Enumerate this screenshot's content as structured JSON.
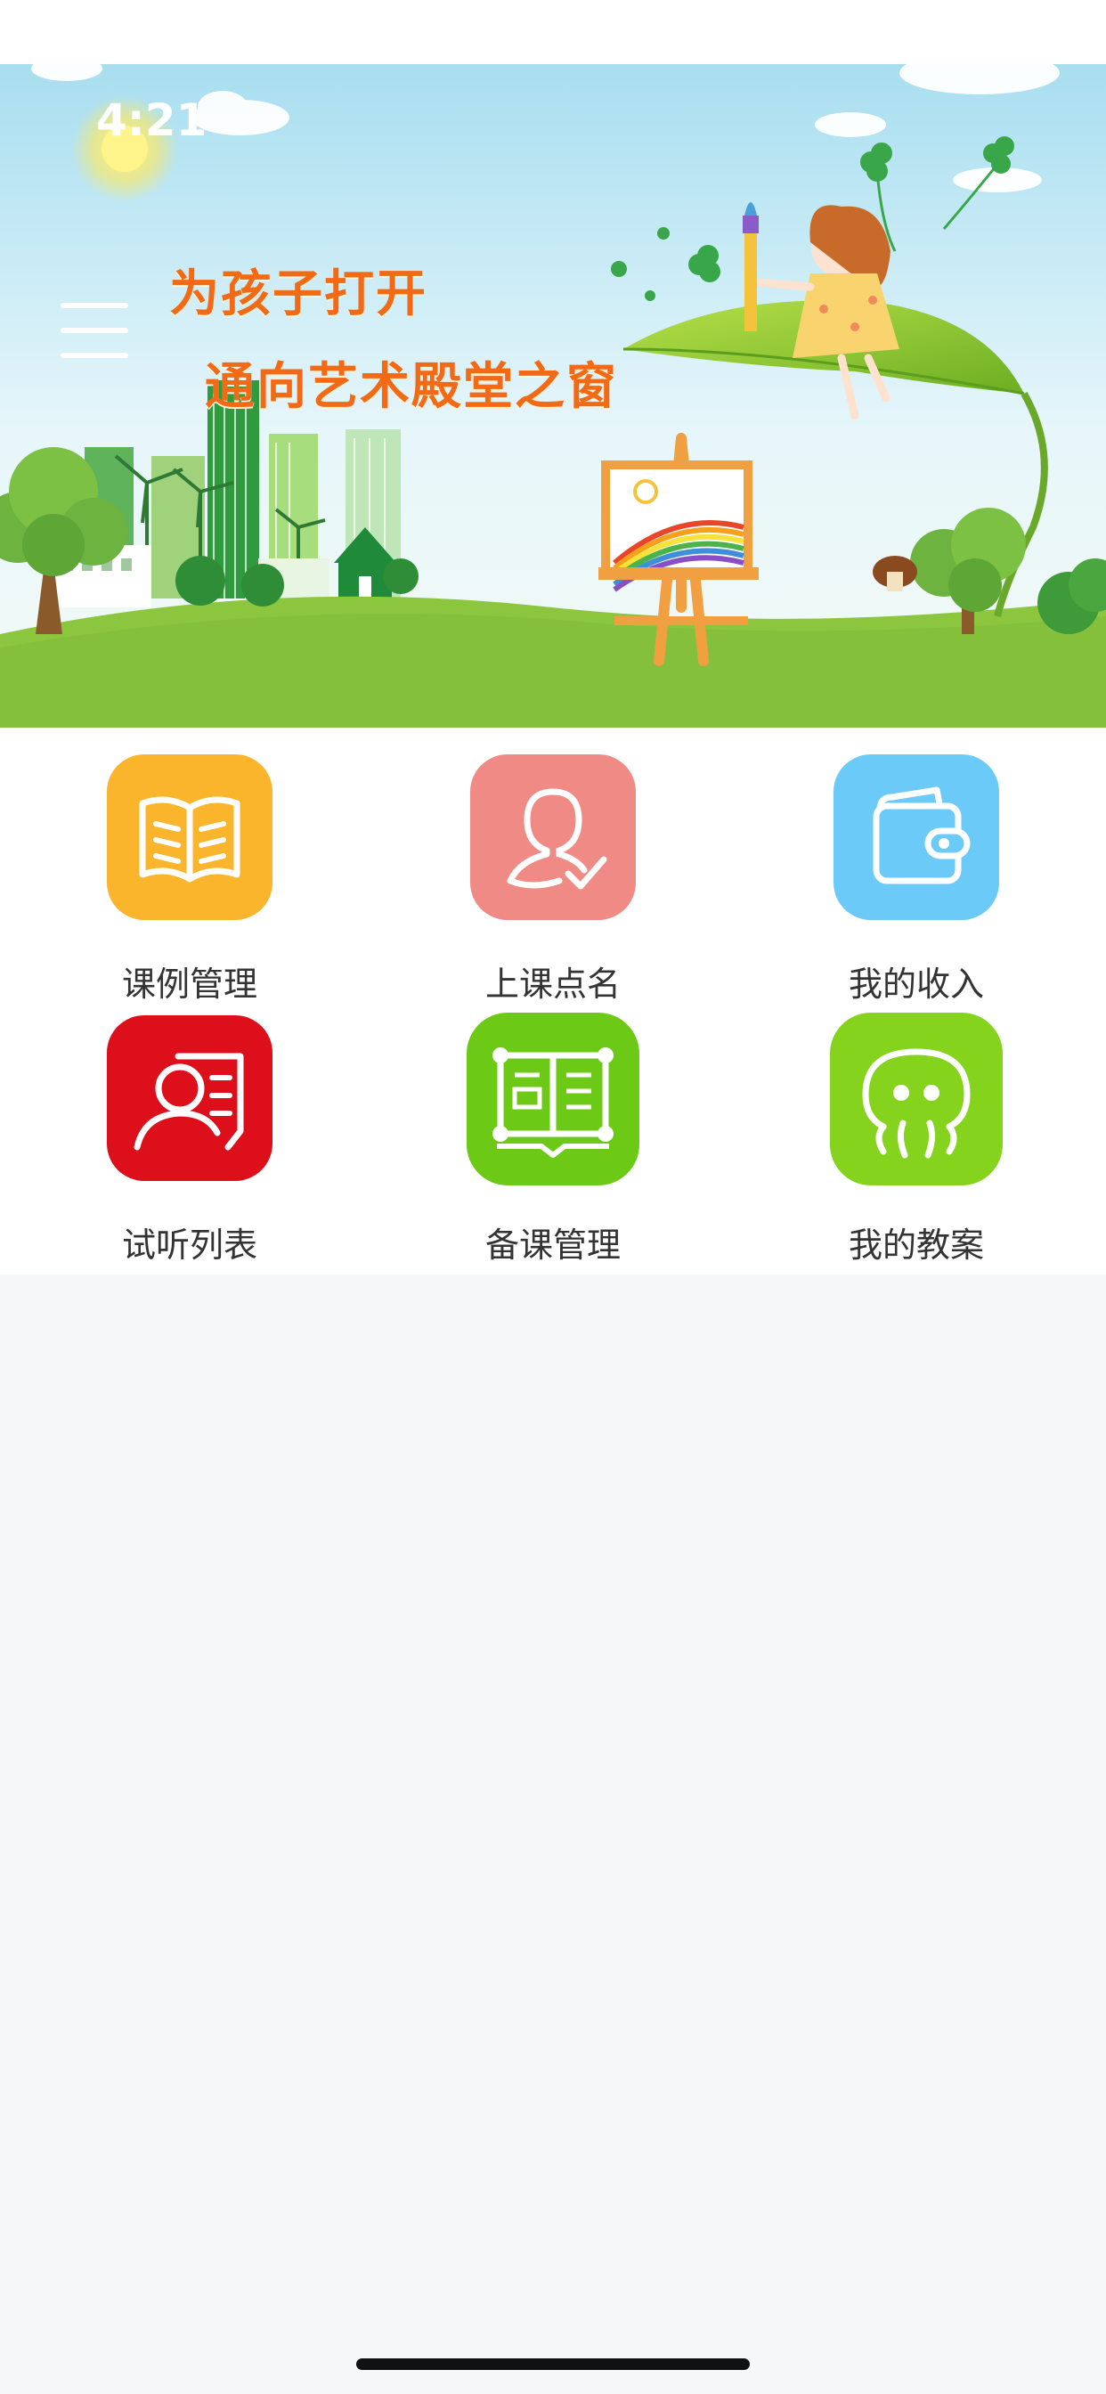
{
  "status_bar": {
    "time": "4:21"
  },
  "banner": {
    "slogan_line1": "为孩子打开",
    "slogan_line2": "通向艺术殿堂之窗"
  },
  "menu": {
    "icon": "hamburger-menu-icon"
  },
  "grid": {
    "items": [
      {
        "label": "课例管理",
        "icon": "open-book-icon",
        "color": "#fbb52d"
      },
      {
        "label": "上课点名",
        "icon": "person-check-icon",
        "color": "#ef8a85"
      },
      {
        "label": "我的收入",
        "icon": "wallet-icon",
        "color": "#6ccaf9"
      },
      {
        "label": "试听列表",
        "icon": "listener-list-icon",
        "color": "#dc0f1a"
      },
      {
        "label": "备课管理",
        "icon": "lesson-book-icon",
        "color": "#6cc916"
      },
      {
        "label": "我的教案",
        "icon": "octopus-plan-icon",
        "color": "#85d31d"
      }
    ]
  },
  "colors": {
    "page_background": "#f5f7f9",
    "slogan": "#f26a16",
    "sky": "#bfe8f2",
    "grass": "#8cc63f"
  }
}
